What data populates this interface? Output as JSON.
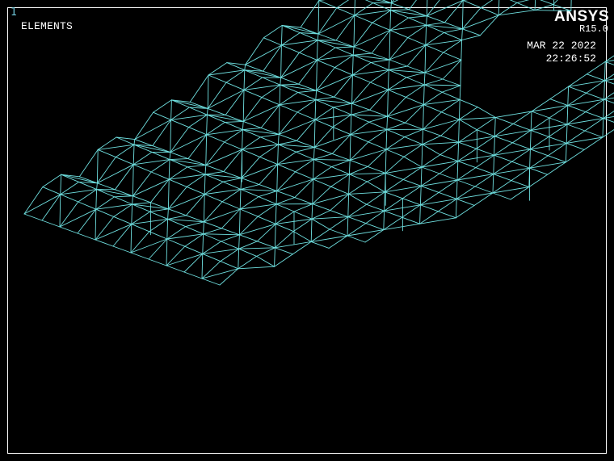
{
  "window_number": "1",
  "plot_label": "ELEMENTS",
  "brand": {
    "logo": "ANSYS",
    "version": "R15.0"
  },
  "datestamp": {
    "date": "MAR 22 2022",
    "time": "22:26:52"
  },
  "colors": {
    "background": "#000000",
    "mesh": "#6fe0e0",
    "text": "#ffffff",
    "window_number": "#6fc6d8"
  }
}
